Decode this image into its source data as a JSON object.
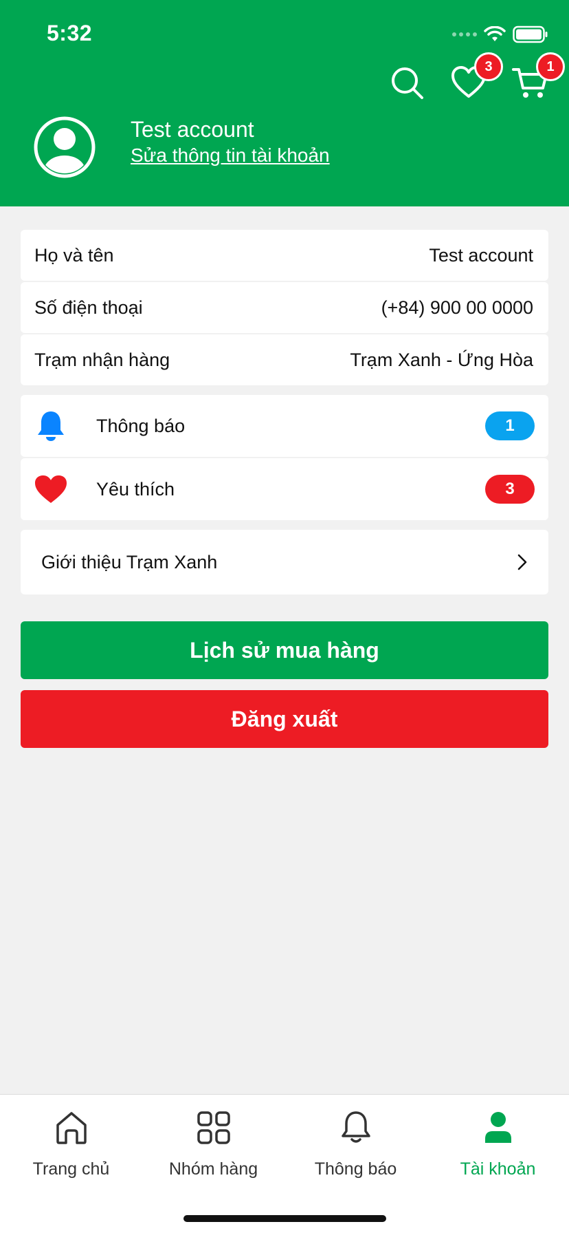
{
  "status_bar": {
    "time": "5:32"
  },
  "header": {
    "wishlist_count": "3",
    "cart_count": "1",
    "profile_name": "Test account",
    "edit_link": "Sửa thông tin tài khoản",
    "background_color": "#00a651"
  },
  "info": {
    "rows": [
      {
        "label": "Họ và tên",
        "value": "Test account"
      },
      {
        "label": "Số điện thoại",
        "value": "(+84) 900 00 0000"
      },
      {
        "label": "Trạm nhận hàng",
        "value": "Trạm Xanh - Ứng Hòa"
      }
    ]
  },
  "menu": {
    "notifications": {
      "label": "Thông báo",
      "count": "1",
      "icon": "bell-icon",
      "color": "#0a84ff"
    },
    "favorites": {
      "label": "Yêu thích",
      "count": "3",
      "icon": "heart-icon",
      "color": "#ed1c24"
    },
    "about": {
      "label": "Giới thiệu Trạm Xanh",
      "icon": "chevron-right-icon"
    }
  },
  "buttons": {
    "history": "Lịch sử mua hàng",
    "logout": "Đăng xuất"
  },
  "tabbar": {
    "tabs": [
      {
        "label": "Trang chủ",
        "icon": "home-icon"
      },
      {
        "label": "Nhóm hàng",
        "icon": "grid-icon"
      },
      {
        "label": "Thông báo",
        "icon": "bell-icon"
      },
      {
        "label": "Tài khoản",
        "icon": "user-icon",
        "active": true
      }
    ],
    "active_color": "#00a651"
  }
}
